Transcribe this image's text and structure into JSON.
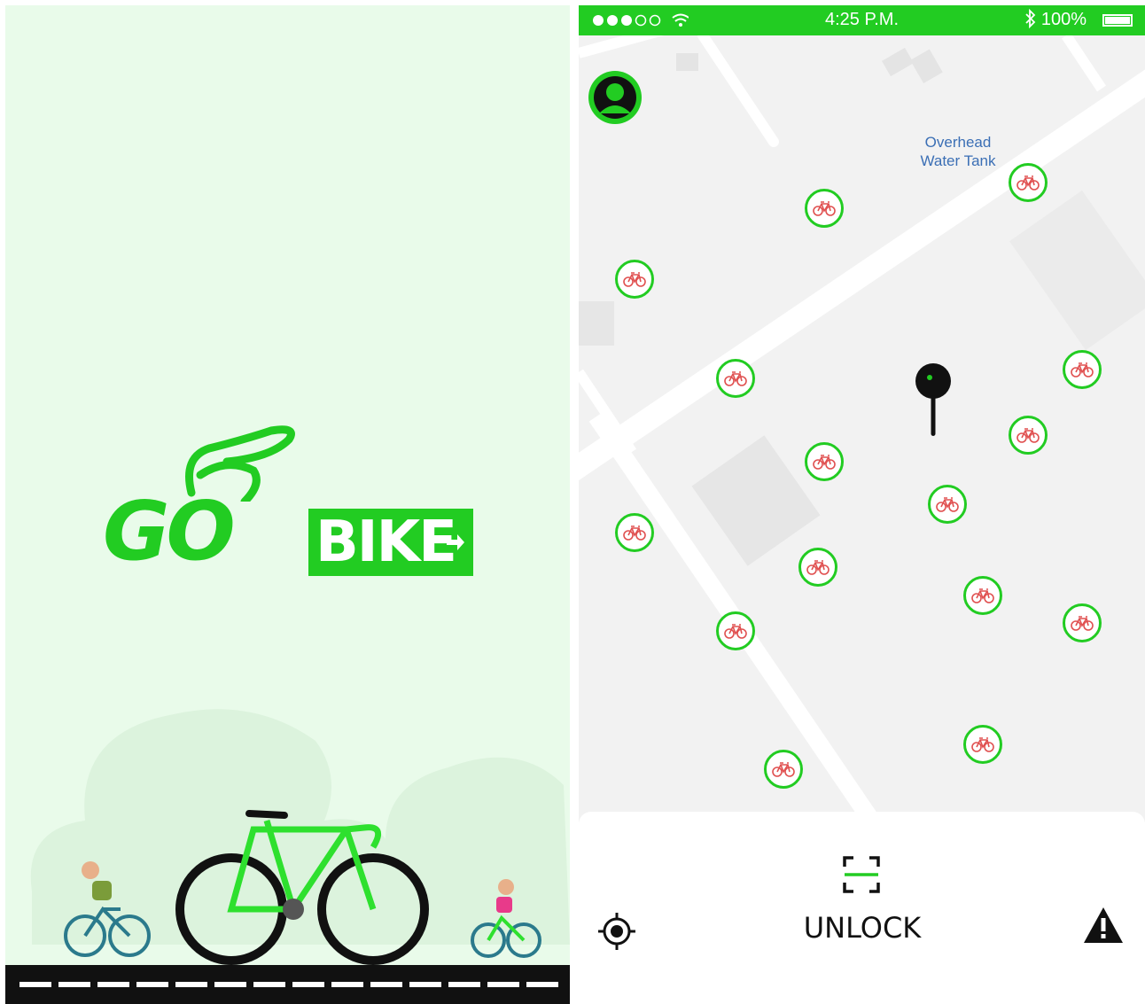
{
  "splash": {
    "logo_go": "GO",
    "logo_bike": "BIKE"
  },
  "status_bar": {
    "time": "4:25 P.M.",
    "battery": "100%"
  },
  "map": {
    "label_line1": "Overhead",
    "label_line2": "Water Tank",
    "bike_markers": [
      {
        "id": 1
      },
      {
        "id": 2
      },
      {
        "id": 3
      },
      {
        "id": 4
      },
      {
        "id": 5
      },
      {
        "id": 6
      },
      {
        "id": 7
      },
      {
        "id": 8
      },
      {
        "id": 9
      },
      {
        "id": 10
      },
      {
        "id": 11
      },
      {
        "id": 12
      },
      {
        "id": 13
      },
      {
        "id": 14
      },
      {
        "id": 15
      },
      {
        "id": 16
      }
    ]
  },
  "bottom_bar": {
    "unlock_label": "UNLOCK"
  },
  "colors": {
    "brand_green": "#22cc22",
    "splash_bg": "#e9fbea",
    "map_bg": "#f2f2f2",
    "map_label": "#3b6fb5",
    "bike_icon": "#e05050"
  },
  "icons": [
    "profile-icon",
    "bike-marker-icon",
    "location-pin-icon",
    "scan-icon",
    "locate-icon",
    "warning-icon",
    "wifi-icon",
    "bluetooth-icon",
    "battery-icon",
    "signal-icon"
  ]
}
